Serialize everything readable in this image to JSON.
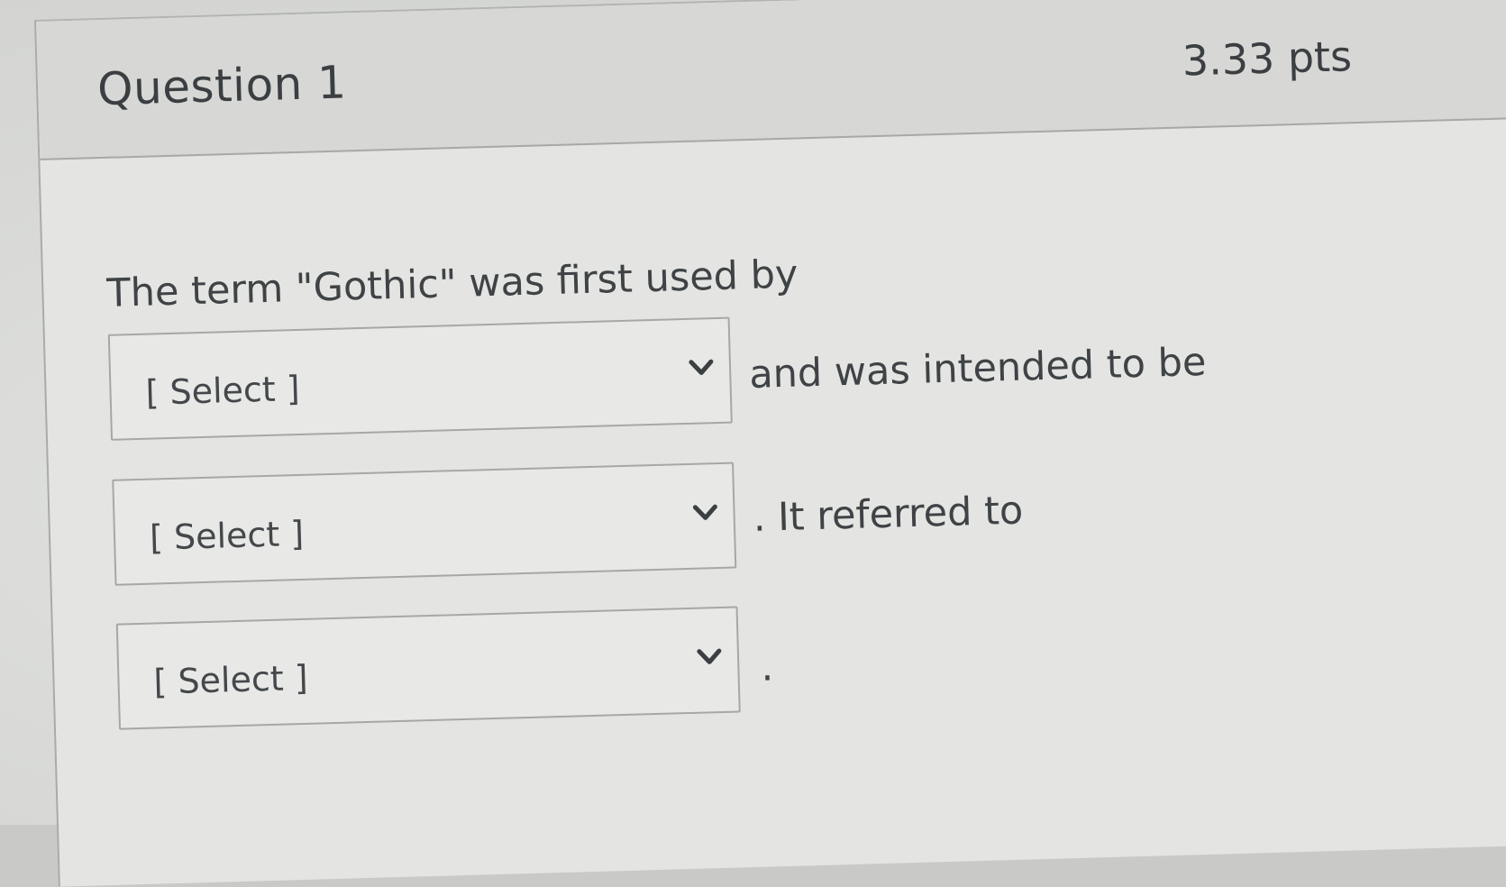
{
  "question": {
    "title": "Question 1",
    "points": "3.33 pts",
    "prompt": "The term \"Gothic\" was first used by",
    "segments": [
      {
        "select_placeholder": "[ Select ]",
        "after_text": "and was intended to be"
      },
      {
        "select_placeholder": "[ Select ]",
        "after_text": ". It referred to"
      },
      {
        "select_placeholder": "[ Select ]",
        "after_text": "."
      }
    ]
  },
  "icons": {
    "dropdown_arrow": "chevron-down-icon"
  },
  "colors": {
    "header_background": "#d7d8d6",
    "body_background": "#e4e5e3",
    "border": "#a7a9a7",
    "text": "#3f4346"
  }
}
